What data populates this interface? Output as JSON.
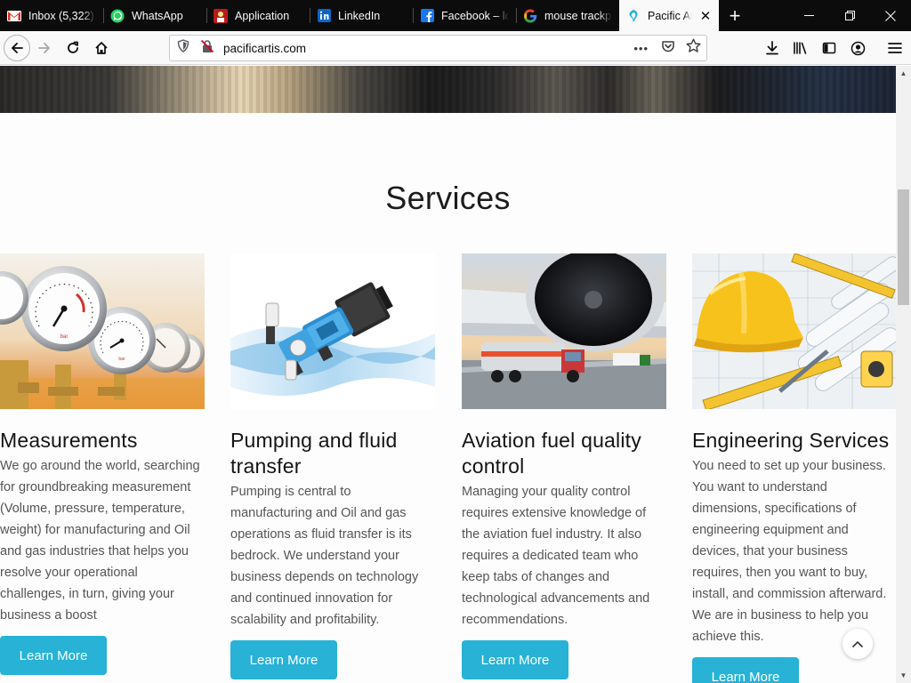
{
  "tabs": [
    {
      "title": "Inbox (5,322)",
      "icon": "gmail-icon"
    },
    {
      "title": "WhatsApp",
      "icon": "whatsapp-icon"
    },
    {
      "title": "Application",
      "icon": "application-icon"
    },
    {
      "title": "LinkedIn",
      "icon": "linkedin-icon"
    },
    {
      "title": "Facebook – lo",
      "icon": "facebook-icon"
    },
    {
      "title": "mouse trackp",
      "icon": "google-icon"
    },
    {
      "title": "Pacific Arti",
      "icon": "pacific-artis-icon",
      "active": true
    }
  ],
  "window_controls": {
    "minimize": "─",
    "restore": "❐",
    "close": "✕"
  },
  "new_tab_label": "+",
  "address_bar": {
    "url": "pacificartis.com",
    "more_label": "•••"
  },
  "page": {
    "section_title": "Services",
    "cards": [
      {
        "title": "Measurements",
        "description": "We go around the world, searching for groundbreaking measurement (Volume, pressure, temperature, weight) for manufacturing and Oil and gas industries that helps you resolve your operational challenges, in turn, giving your business a boost",
        "button": "Learn More",
        "image": "pressure-gauges-image"
      },
      {
        "title": "Pumping and fluid transfer",
        "description": "Pumping is central to manufacturing and Oil and gas operations as fluid transfer is its bedrock. We understand your business depends on technology and continued innovation for scalability and profitability.",
        "button": "Learn More",
        "image": "fluid-pump-image"
      },
      {
        "title": "Aviation fuel quality control",
        "description": "Managing your quality control requires extensive knowledge of the aviation fuel industry. It also requires a dedicated team who keep tabs of changes and technological advancements and recommendations.",
        "button": "Learn More",
        "image": "aircraft-fuel-truck-image"
      },
      {
        "title": "Engineering Services",
        "description": "You need to set up your business. You want to understand dimensions, specifications of engineering equipment and devices, that your business requires, then you want to buy, install, and commission afterward. We are in business to help you achieve this.",
        "button": "Learn More",
        "image": "hardhat-blueprints-image"
      }
    ]
  },
  "colors": {
    "accent": "#27b2d6",
    "tabbar": "#0c0c0d",
    "toolbar": "#f9f9fa"
  }
}
